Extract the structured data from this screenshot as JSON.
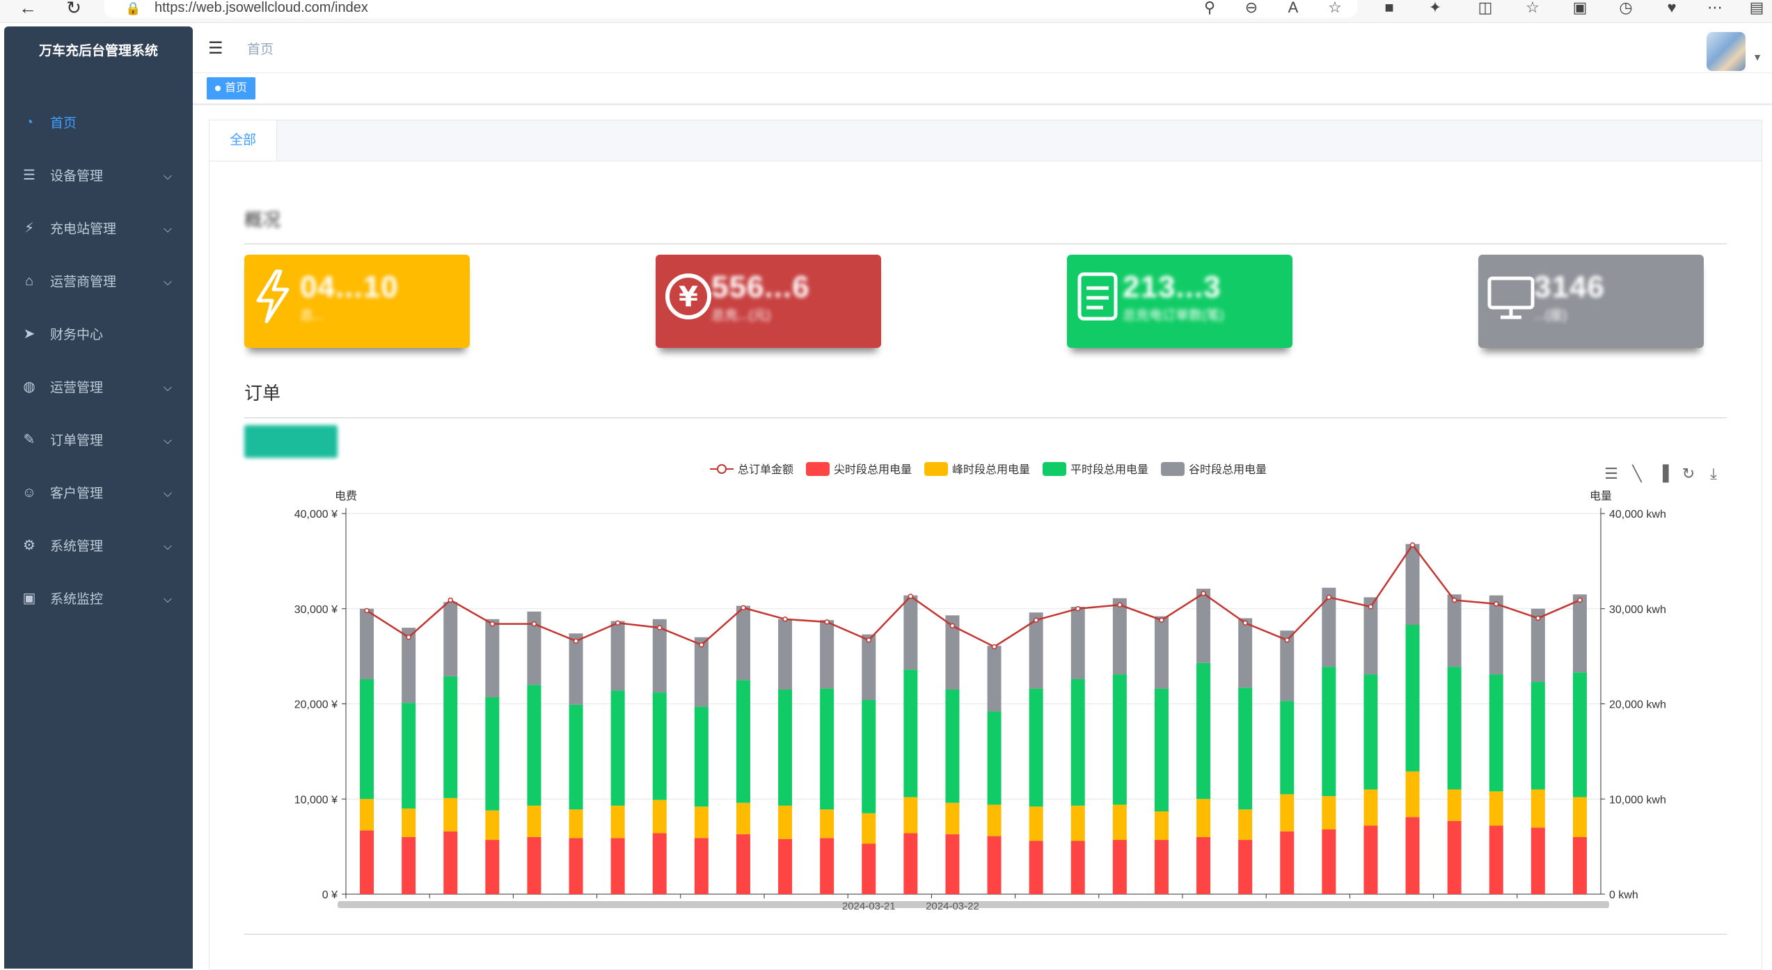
{
  "browser": {
    "url": "https://web.jsowellcloud.com/index"
  },
  "sidebar": {
    "title": "万车充后台管理系统",
    "items": [
      {
        "label": "首页",
        "icon": "dashboard-icon",
        "active": true,
        "expandable": false
      },
      {
        "label": "设备管理",
        "icon": "list-icon",
        "expandable": true
      },
      {
        "label": "充电站管理",
        "icon": "station-icon",
        "expandable": true
      },
      {
        "label": "运营商管理",
        "icon": "bank-icon",
        "expandable": true
      },
      {
        "label": "财务中心",
        "icon": "send-icon",
        "expandable": false
      },
      {
        "label": "运营管理",
        "icon": "globe-icon",
        "expandable": true
      },
      {
        "label": "订单管理",
        "icon": "order-icon",
        "expandable": true
      },
      {
        "label": "客户管理",
        "icon": "users-icon",
        "expandable": true
      },
      {
        "label": "系统管理",
        "icon": "gear-icon",
        "expandable": true
      },
      {
        "label": "系统监控",
        "icon": "monitor-icon",
        "expandable": true
      }
    ]
  },
  "header": {
    "breadcrumb": "首页"
  },
  "tags": {
    "active": "首页"
  },
  "main": {
    "tab": "全部",
    "overview_title": "概况",
    "orders_title": "订单",
    "cards": [
      {
        "color": "#ffbb00",
        "icon": "lightning-icon",
        "value": "04...10",
        "label": "总..."
      },
      {
        "color": "#c94242",
        "icon": "yuan-icon",
        "value": "556...6",
        "label": "总充...(元)"
      },
      {
        "color": "#11cc66",
        "icon": "document-icon",
        "value": "213...3",
        "label": "总充电订单数(笔)"
      },
      {
        "color": "#909399",
        "icon": "monitor-icon",
        "value": "3146",
        "label": "...(座)"
      }
    ]
  },
  "chart_data": {
    "type": "bar",
    "legend": [
      "总订单金额",
      "尖时段总用电量",
      "峰时段总用电量",
      "平时段总用电量",
      "谷时段总用电量"
    ],
    "legend_position": "top-center",
    "colors": [
      "#c23531",
      "#ff4444",
      "#ffbb00",
      "#11cc66",
      "#909399"
    ],
    "left_axis": {
      "name": "电费",
      "ticks": [
        "0 ¥",
        "10,000 ¥",
        "20,000 ¥",
        "30,000 ¥",
        "40,000 ¥"
      ],
      "range": [
        0,
        40000
      ]
    },
    "right_axis": {
      "name": "电量",
      "ticks": [
        "0 kwh",
        "10,000 kwh",
        "20,000 kwh",
        "30,000 kwh",
        "40,000 kwh"
      ],
      "range": [
        0,
        40000
      ]
    },
    "x_ticks_visible": [
      "2024-03-21",
      "2024-03-22"
    ],
    "grid": true,
    "toolbox": [
      "data-view-icon",
      "line-chart-icon",
      "bar-chart-icon",
      "restore-icon",
      "download-icon"
    ],
    "series": [
      {
        "name": "尖时段总用电量",
        "values": [
          6700,
          6000,
          6600,
          5700,
          6000,
          5900,
          5900,
          6400,
          5900,
          6300,
          5800,
          5900,
          5300,
          6400,
          6300,
          6100,
          5600,
          5600,
          5700,
          5700,
          6000,
          5700,
          6600,
          6800,
          7200,
          8100,
          7700,
          7200,
          7000,
          6000
        ]
      },
      {
        "name": "峰时段总用电量",
        "values": [
          3300,
          3000,
          3500,
          3100,
          3300,
          3000,
          3400,
          3500,
          3300,
          3300,
          3500,
          3000,
          3200,
          3800,
          3300,
          3300,
          3600,
          3700,
          3700,
          3000,
          4000,
          3200,
          3900,
          3500,
          3800,
          4800,
          3300,
          3600,
          4000,
          4200
        ]
      },
      {
        "name": "平时段总用电量",
        "values": [
          12600,
          11100,
          12800,
          11900,
          12700,
          11000,
          12100,
          11300,
          10500,
          12900,
          12200,
          12700,
          11900,
          13400,
          11900,
          9800,
          12400,
          13300,
          13700,
          12900,
          14300,
          12800,
          9800,
          13600,
          12100,
          15400,
          12900,
          12300,
          11300,
          13100
        ]
      },
      {
        "name": "谷时段总用电量",
        "values": [
          7400,
          7900,
          7800,
          8200,
          7700,
          7500,
          7300,
          7700,
          7300,
          7800,
          7400,
          7200,
          6900,
          7800,
          7800,
          6900,
          8000,
          7600,
          8000,
          7600,
          7800,
          7300,
          7400,
          8300,
          8100,
          8500,
          7600,
          8300,
          7700,
          8200
        ]
      },
      {
        "name": "总订单金额",
        "values": [
          29800,
          27000,
          30900,
          28400,
          28400,
          26600,
          28500,
          28000,
          26200,
          30100,
          28900,
          28600,
          26700,
          31300,
          28200,
          26000,
          28800,
          30000,
          30400,
          28800,
          31600,
          28500,
          26700,
          31200,
          30200,
          36700,
          30900,
          30500,
          29000,
          30900
        ]
      }
    ]
  }
}
